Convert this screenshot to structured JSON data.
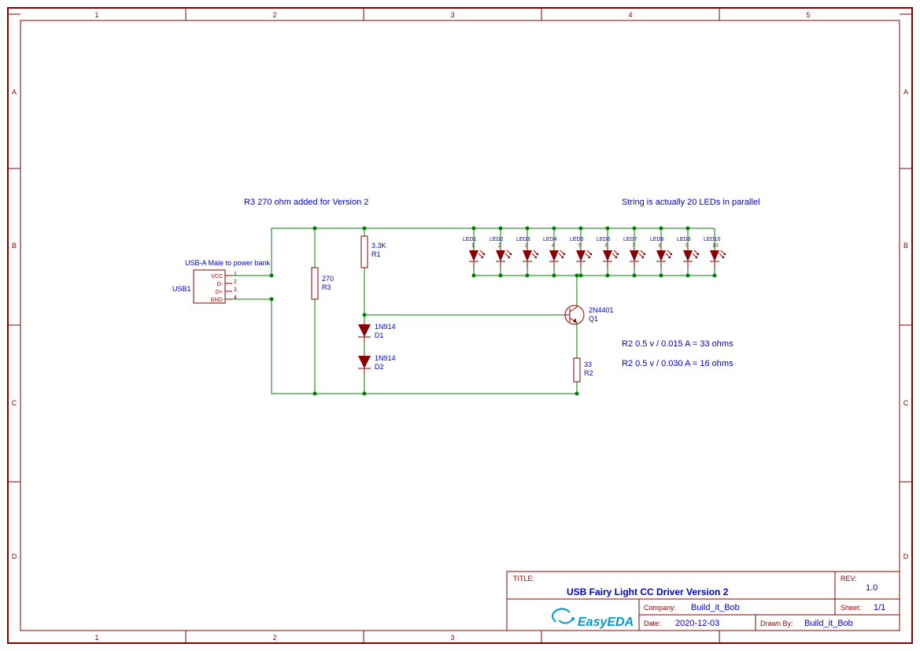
{
  "notes": {
    "r3_added": "R3 270 ohm added for Version 2",
    "string_parallel": "String is actually 20 LEDs in parallel",
    "usb_label": "USB-A Male to power bank",
    "r2_calc1": "R2 0.5 v / 0.015 A = 33 ohms",
    "r2_calc2": "R2 0.5 v / 0.030 A = 16 ohms"
  },
  "components": {
    "usb": {
      "ref": "USB1",
      "pins": {
        "p1": "VCC",
        "p2": "D-",
        "p3": "D+",
        "p4": "GND"
      },
      "nums": {
        "1": "1",
        "2": "2",
        "3": "3",
        "4": "4"
      }
    },
    "r1": {
      "ref": "R1",
      "val": "3.3K"
    },
    "r2": {
      "ref": "R2",
      "val": "33"
    },
    "r3": {
      "ref": "R3",
      "val": "270"
    },
    "d1": {
      "ref": "D1",
      "val": "1N914"
    },
    "d2": {
      "ref": "D2",
      "val": "1N914"
    },
    "q1": {
      "ref": "Q1",
      "val": "2N4401"
    },
    "leds": [
      {
        "ref": "LED1",
        "num": "1"
      },
      {
        "ref": "LED2",
        "num": "2"
      },
      {
        "ref": "LED3",
        "num": "3"
      },
      {
        "ref": "LED4",
        "num": "4"
      },
      {
        "ref": "LED5",
        "num": "5"
      },
      {
        "ref": "LED6",
        "num": "6"
      },
      {
        "ref": "LED7",
        "num": "7"
      },
      {
        "ref": "LED8",
        "num": "8"
      },
      {
        "ref": "LED9",
        "num": "9"
      },
      {
        "ref": "LED10",
        "num": "10"
      }
    ]
  },
  "titleblock": {
    "title_label": "TITLE:",
    "title": "USB Fairy Light CC Driver Version 2",
    "rev_label": "REV:",
    "rev": "1.0",
    "company_label": "Company:",
    "company": "Build_it_Bob",
    "sheet_label": "Sheet:",
    "sheet": "1/1",
    "date_label": "Date:",
    "date": "2020-12-03",
    "drawn_label": "Drawn By:",
    "drawn": "Build_it_Bob",
    "logo": "EasyEDA"
  },
  "frame": {
    "cols": [
      "1",
      "2",
      "3",
      "4",
      "5"
    ],
    "rows": [
      "A",
      "B",
      "C",
      "D"
    ]
  }
}
